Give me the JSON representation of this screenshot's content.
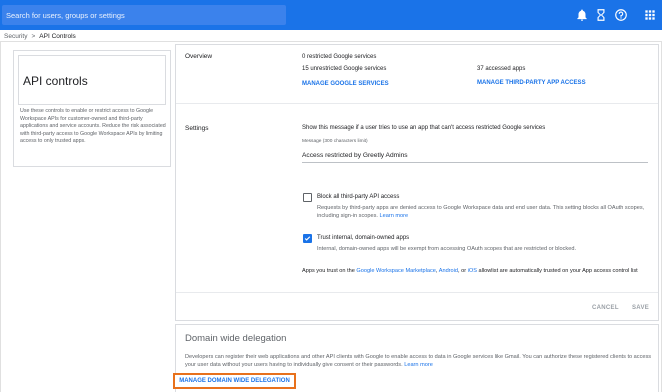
{
  "search": {
    "placeholder": "Search for users, groups or settings"
  },
  "topbar_icons": [
    "bell-icon",
    "hourglass-icon",
    "help-icon",
    "apps-grid-icon"
  ],
  "breadcrumb": {
    "parent": "Security",
    "separator": ">",
    "current": "API Controls"
  },
  "left_panel": {
    "title": "API controls",
    "description": "Use these controls to enable or restrict access to Google Workspace APIs for customer-owned and third-party applications and service accounts. Reduce the risk associated with third-party access to Google Workspace APIs by limiting access to only trusted apps."
  },
  "overview": {
    "label": "Overview",
    "restricted": "0 restricted Google services",
    "unrestricted": "15 unrestricted Google services",
    "accessed_apps": "37 accessed apps",
    "manage_google_services": "MANAGE GOOGLE SERVICES",
    "manage_third_party": "MANAGE THIRD-PARTY APP ACCESS"
  },
  "settings": {
    "label": "Settings",
    "show_message": "Show this message if a user tries to use an app that can't access restricted Google services",
    "message_label": "Message (300 characters limit)",
    "message_value": "Access restricted by Greetly Admins",
    "block_all": {
      "label": "Block all third-party API access",
      "checked": false,
      "description": "Requests by third-party apps are denied access to Google Workspace data and end user data. This setting blocks all OAuth scopes, including sign-in scopes.",
      "learn_more": "Learn more"
    },
    "trust_internal": {
      "label": "Trust internal, domain-owned apps",
      "checked": true,
      "description": "Internal, domain-owned apps will be exempt from accessing OAuth scopes that are restricted or blocked."
    },
    "marketplace_note": {
      "before": "Apps you trust on the ",
      "marketplace": "Google Workspace Marketplace",
      "comma": ", ",
      "android": "Android",
      "or": ", or ",
      "ios": "iOS",
      "after": " allowlist are automatically trusted on your App access control list"
    },
    "cancel": "CANCEL",
    "save": "SAVE"
  },
  "domain_delegation": {
    "title": "Domain wide delegation",
    "description": "Developers can register their web applications and other API clients with Google to enable access to data in Google services like Gmail. You can authorize these registered clients to access your user data without your users having to individually give consent or their passwords.",
    "learn_more": "Learn more",
    "manage_button": "MANAGE DOMAIN WIDE DELEGATION"
  },
  "colors": {
    "brand_blue": "#1a73e8",
    "highlight_orange": "#e8711c"
  }
}
